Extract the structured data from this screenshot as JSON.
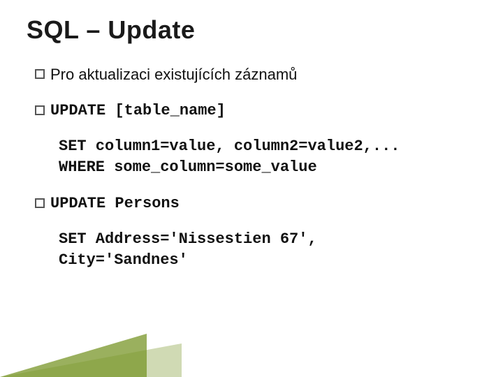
{
  "title": "SQL – Update",
  "bullets": {
    "b1": {
      "text": "Pro aktualizaci existujících záznamů"
    },
    "b2": {
      "first": "UPDATE [table_name]",
      "line2": "SET column1=value, column2=value2,...",
      "line3": "WHERE some_column=some_value"
    },
    "b3": {
      "first": "UPDATE Persons",
      "line2": "SET Address='Nissestien 67',",
      "line3": "City='Sandnes'"
    }
  }
}
